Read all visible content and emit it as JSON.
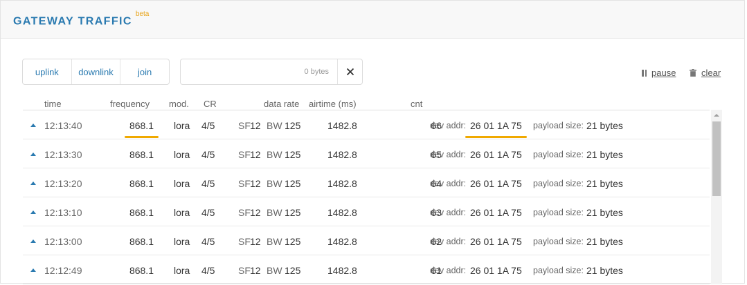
{
  "header": {
    "title": "GATEWAY TRAFFIC",
    "badge": "beta"
  },
  "filters": [
    "uplink",
    "downlink",
    "join"
  ],
  "search": {
    "value": "",
    "placeholder": "",
    "bytes_label": "0 bytes"
  },
  "controls": {
    "pause_label": "pause",
    "clear_label": "clear"
  },
  "columns": {
    "time": "time",
    "frequency": "frequency",
    "mod": "mod.",
    "cr": "CR",
    "data_rate": "data rate",
    "airtime": "airtime (ms)",
    "cnt": "cnt"
  },
  "labels": {
    "dev_addr": "dev addr:",
    "payload_size": "payload size:",
    "sf": "SF",
    "bw": "BW"
  },
  "rows": [
    {
      "direction": "uplink",
      "time": "12:13:40",
      "frequency": "868.1",
      "mod": "lora",
      "cr": "4/5",
      "sf": "12",
      "bw": "125",
      "airtime": "1482.8",
      "cnt": "66",
      "dev_addr": "26 01 1A 75",
      "payload_size": "21 bytes",
      "highlighted": true
    },
    {
      "direction": "uplink",
      "time": "12:13:30",
      "frequency": "868.1",
      "mod": "lora",
      "cr": "4/5",
      "sf": "12",
      "bw": "125",
      "airtime": "1482.8",
      "cnt": "65",
      "dev_addr": "26 01 1A 75",
      "payload_size": "21 bytes",
      "highlighted": false
    },
    {
      "direction": "uplink",
      "time": "12:13:20",
      "frequency": "868.1",
      "mod": "lora",
      "cr": "4/5",
      "sf": "12",
      "bw": "125",
      "airtime": "1482.8",
      "cnt": "64",
      "dev_addr": "26 01 1A 75",
      "payload_size": "21 bytes",
      "highlighted": false
    },
    {
      "direction": "uplink",
      "time": "12:13:10",
      "frequency": "868.1",
      "mod": "lora",
      "cr": "4/5",
      "sf": "12",
      "bw": "125",
      "airtime": "1482.8",
      "cnt": "63",
      "dev_addr": "26 01 1A 75",
      "payload_size": "21 bytes",
      "highlighted": false
    },
    {
      "direction": "uplink",
      "time": "12:13:00",
      "frequency": "868.1",
      "mod": "lora",
      "cr": "4/5",
      "sf": "12",
      "bw": "125",
      "airtime": "1482.8",
      "cnt": "62",
      "dev_addr": "26 01 1A 75",
      "payload_size": "21 bytes",
      "highlighted": false
    },
    {
      "direction": "uplink",
      "time": "12:12:49",
      "frequency": "868.1",
      "mod": "lora",
      "cr": "4/5",
      "sf": "12",
      "bw": "125",
      "airtime": "1482.8",
      "cnt": "61",
      "dev_addr": "26 01 1A 75",
      "payload_size": "21 bytes",
      "highlighted": false
    }
  ],
  "colors": {
    "accent": "#2a7ab0",
    "highlight": "#f0a900",
    "beta": "#e8a317"
  }
}
